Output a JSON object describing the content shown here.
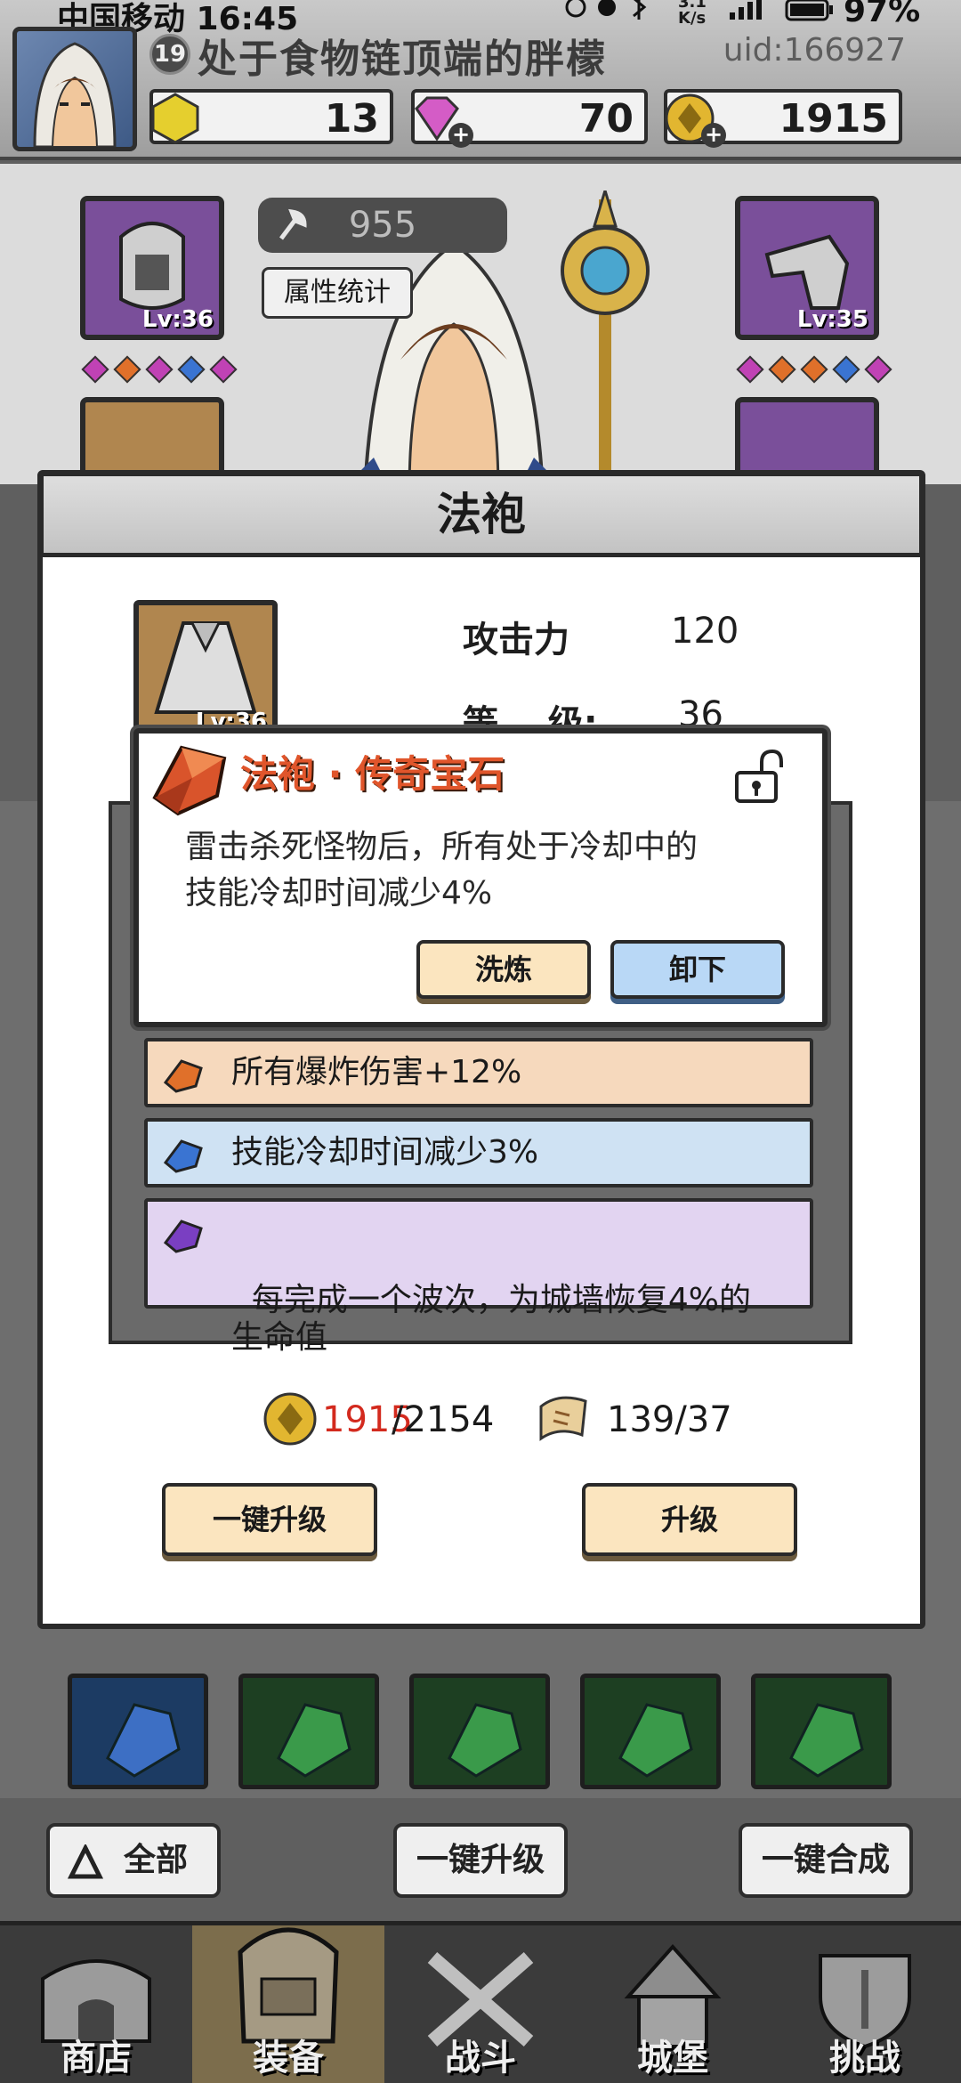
{
  "status_bar": {
    "carrier_time": "中国移动 16:45",
    "speed": "3.1\nK/s",
    "battery": "97%"
  },
  "player": {
    "level": "19",
    "name": "处于食物链顶端的胖檬",
    "uid": "uid:166927"
  },
  "resources": {
    "gems_yellow": "13",
    "diamonds": "70",
    "gold": "1915"
  },
  "power": "955",
  "stats_button": "属性统计",
  "slot_left_level": "Lv:36",
  "slot_right_level": "Lv:35",
  "panel": {
    "title": "法袍",
    "item_level": "Lv:36",
    "attack_label": "攻击力",
    "attack_value": "120",
    "level_label": "等    级:",
    "level_value": "36",
    "gem_effects": [
      {
        "text": "所有爆炸伤害+12%",
        "color": "#f6d9bd"
      },
      {
        "text": "技能冷却时间减少3%",
        "color": "#cfe2f3"
      },
      {
        "text": "每完成一个波次，为城墙恢复4%的\n生命值",
        "color": "#e2d4f1"
      }
    ],
    "cost_gold_have": "1915",
    "cost_gold_need": "/2154",
    "cost_scroll": "139/37",
    "upgrade_all_button": "一键升级",
    "upgrade_button": "升级"
  },
  "popup": {
    "title": "法袍 · 传奇宝石",
    "description": "雷击杀死怪物后，所有处于冷却中的\n技能冷却时间减少4%",
    "refine_button": "洗炼",
    "unequip_button": "卸下"
  },
  "bottom_actions": {
    "filter_all": "全部",
    "upgrade_all": "一键升级",
    "merge_all": "一键合成"
  },
  "nav": [
    {
      "label": "商店"
    },
    {
      "label": "装备"
    },
    {
      "label": "战斗"
    },
    {
      "label": "城堡"
    },
    {
      "label": "挑战"
    }
  ],
  "colors": {
    "accent_red": "#e0552b",
    "cream_button": "#fbe5bf",
    "blue_button": "#b9d8f6",
    "slot_purple": "#7a4f9a"
  }
}
